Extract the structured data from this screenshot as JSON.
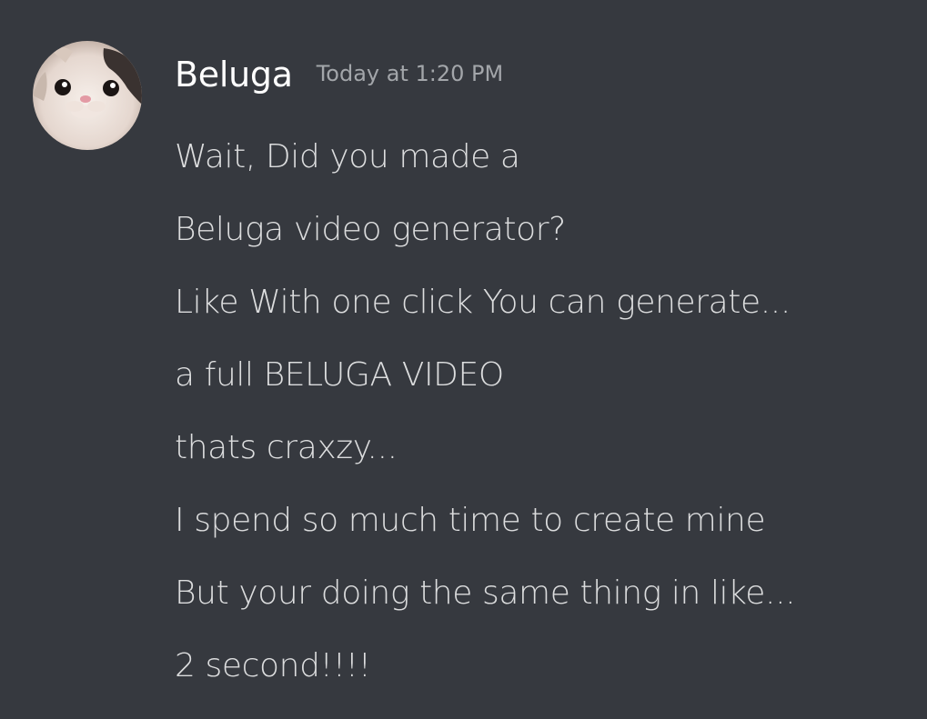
{
  "message": {
    "author": "Beluga",
    "timestamp": "Today at 1:20 PM",
    "avatar_icon": "beluga-cat-avatar",
    "lines": [
      "Wait, Did you made a",
      "Beluga video generator?",
      "Like With one click You can generate...",
      "a full BELUGA VIDEO",
      "thats craxzy...",
      "I spend so much time to create mine",
      "But your doing the same thing in like...",
      "2 second!!!!"
    ]
  },
  "colors": {
    "background": "#36393f",
    "username": "#ffffff",
    "timestamp": "#a3a6aa",
    "text": "#dcddde"
  }
}
